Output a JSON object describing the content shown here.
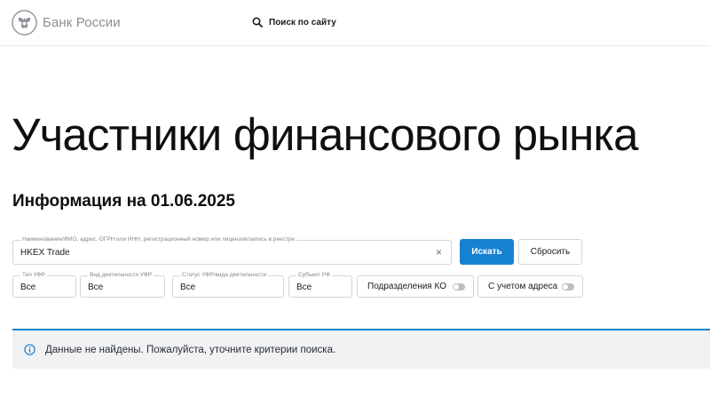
{
  "header": {
    "brand": "Банк России",
    "search_label": "Поиск по сайту"
  },
  "main": {
    "page_title": "Участники финансового рынка",
    "info_title": "Информация на 01.06.2025"
  },
  "search_form": {
    "main_field": {
      "label": "Наименование/ФИО, адрес, ОГРН или ИНН, регистрационный номер или лицензия/запись в реестре",
      "value": "HKEX Trade",
      "clear_glyph": "×"
    },
    "search_button": "Искать",
    "reset_button": "Сбросить",
    "filters": [
      {
        "label": "Тип УФР",
        "value": "Все"
      },
      {
        "label": "Вид деятельности УФР",
        "value": "Все"
      },
      {
        "label": "Статус УФР/вида деятельности",
        "value": "Все"
      },
      {
        "label": "Субъект РФ",
        "value": "Все"
      }
    ],
    "toggles": [
      {
        "label": "Подразделения КО",
        "on": false
      },
      {
        "label": "С учетом адреса",
        "on": false
      }
    ]
  },
  "notice": {
    "text": "Данные не найдены. Пожалуйста, уточните критерии поиска."
  },
  "colors": {
    "accent": "#1582d1",
    "brand_gray": "#8a8f96",
    "border": "#d2d6db",
    "notice_bg": "#f0f2f4"
  },
  "icons": {
    "logo": "double-headed-eagle-emblem",
    "search": "search-icon",
    "info": "info-icon"
  }
}
